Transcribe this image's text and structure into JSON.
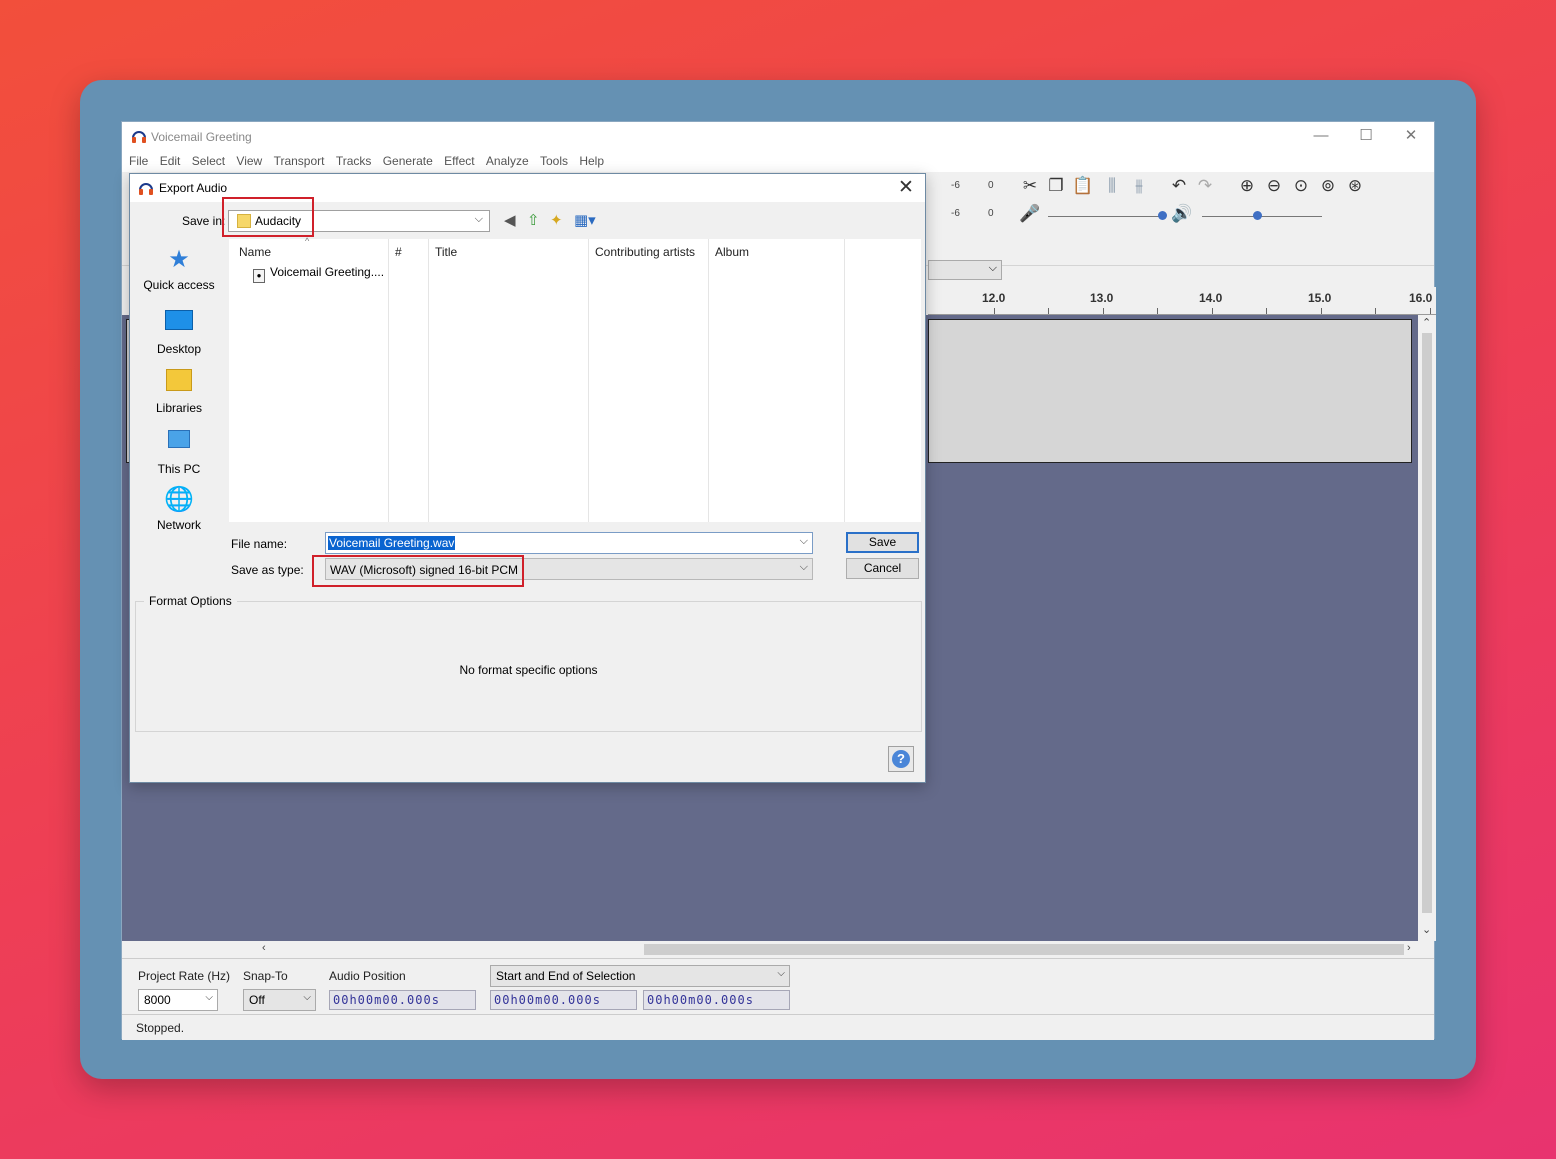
{
  "app": {
    "title": "Voicemail Greeting",
    "menu": [
      "File",
      "Edit",
      "Select",
      "View",
      "Transport",
      "Tracks",
      "Generate",
      "Effect",
      "Analyze",
      "Tools",
      "Help"
    ],
    "meter_rec": [
      "-6",
      "0"
    ],
    "meter_play": [
      "-6",
      "0"
    ],
    "ruler_ticks": [
      "12.0",
      "13.0",
      "14.0",
      "15.0",
      "16.0"
    ]
  },
  "selection_toolbar": {
    "project_rate_label": "Project Rate (Hz)",
    "project_rate_value": "8000",
    "snap_to_label": "Snap-To",
    "snap_to_value": "Off",
    "audio_position_label": "Audio Position",
    "audio_position_value": "00h00m00.000s",
    "selection_mode": "Start and End of Selection",
    "selection_start": "00h00m00.000s",
    "selection_end": "00h00m00.000s"
  },
  "status": {
    "text": "Stopped."
  },
  "dialog": {
    "title": "Export Audio",
    "save_in_label": "Save in:",
    "save_in_value": "Audacity",
    "places": [
      {
        "label": "Quick access",
        "icon": "star-icon"
      },
      {
        "label": "Desktop",
        "icon": "desktop-icon"
      },
      {
        "label": "Libraries",
        "icon": "libraries-icon"
      },
      {
        "label": "This PC",
        "icon": "computer-icon"
      },
      {
        "label": "Network",
        "icon": "network-icon"
      }
    ],
    "columns": [
      "Name",
      "#",
      "Title",
      "Contributing artists",
      "Album"
    ],
    "files": [
      {
        "name": "Voicemail Greeting...."
      }
    ],
    "file_name_label": "File name:",
    "file_name_value": "Voicemail Greeting.wav",
    "save_type_label": "Save as type:",
    "save_type_value": "WAV (Microsoft) signed 16-bit PCM",
    "save_button": "Save",
    "cancel_button": "Cancel",
    "format_options_label": "Format Options",
    "format_options_message": "No format specific options",
    "help_button": "?"
  },
  "colors": {
    "highlight": "#d0202a",
    "track_bg": "#646a8a",
    "frame": "#6591b3",
    "selection": "#0a64d0"
  }
}
